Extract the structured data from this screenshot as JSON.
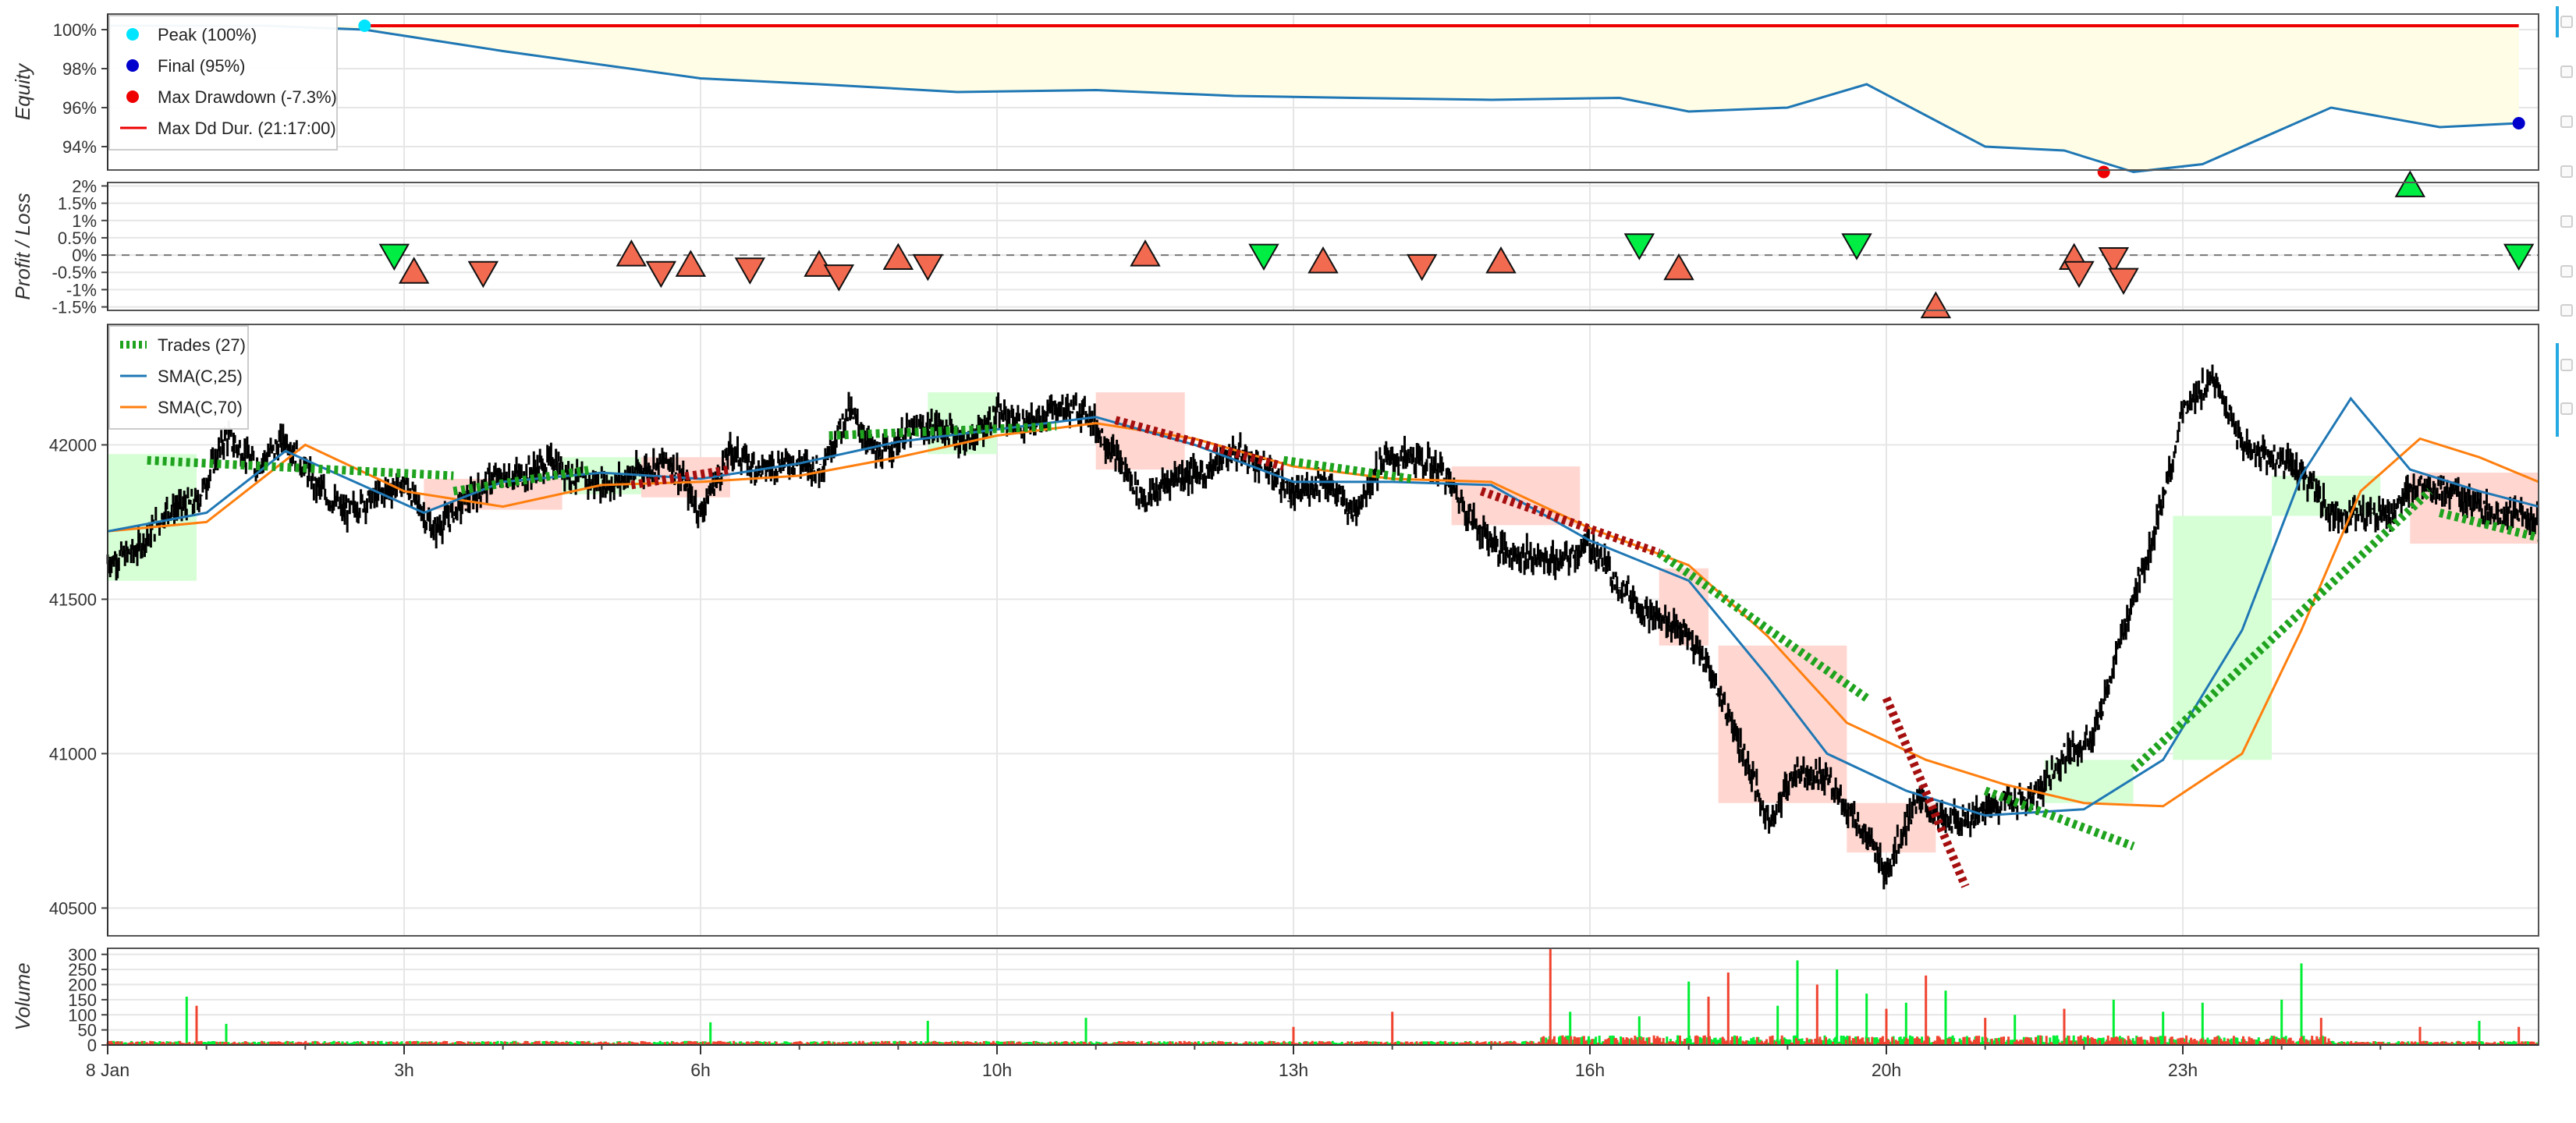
{
  "chart_data": [
    {
      "type": "area",
      "panel": "equity",
      "ylabel": "Equity",
      "yticks": [
        "100%",
        "98%",
        "96%",
        "94%"
      ],
      "ytick_values": [
        100,
        98,
        96,
        94
      ],
      "ylim": [
        92.8,
        100.8
      ],
      "grid": true,
      "legend_position": "top-left",
      "legend": [
        {
          "label": "Peak (100%)",
          "color": "#00e5ff",
          "marker": "dot"
        },
        {
          "label": "Final (95%)",
          "color": "#0000cc",
          "marker": "dot"
        },
        {
          "label": "Max Drawdown (-7.3%)",
          "color": "#ee0000",
          "marker": "dot"
        },
        {
          "label": "Max Dd Dur. (21:17:00)",
          "color": "#ee0000",
          "marker": "line"
        }
      ],
      "series": [
        {
          "name": "Equity",
          "color": "#1f77b4",
          "x": [
            0,
            1.6,
            2.6,
            4,
            6,
            7.2,
            8.6,
            10,
            11.4,
            12.6,
            14,
            15.3,
            16,
            17,
            17.8,
            18.4,
            19,
            19.8,
            20.5,
            21.2,
            22.5,
            23.6,
            24.4
          ],
          "values": [
            100.2,
            100.2,
            100.0,
            98.9,
            97.5,
            97.2,
            96.8,
            96.9,
            96.6,
            96.5,
            96.4,
            96.5,
            95.8,
            96.0,
            97.2,
            95.6,
            94.0,
            93.8,
            92.7,
            93.1,
            96.0,
            95.0,
            95.2
          ]
        }
      ],
      "markers": [
        {
          "name": "Peak",
          "x": 2.6,
          "y": 100.2,
          "color": "#00e5ff"
        },
        {
          "name": "Final",
          "x": 24.4,
          "y": 95.2,
          "color": "#0000cc"
        },
        {
          "name": "Max Drawdown",
          "x": 20.2,
          "y": 92.7,
          "color": "#ee0000"
        }
      ],
      "max_dd_duration": {
        "x_start": 2.6,
        "x_end": 24.4,
        "y": 100.2,
        "color": "#ee0000"
      },
      "drawdown_fill_color": "#fffde6"
    },
    {
      "type": "scatter",
      "panel": "profit_loss",
      "ylabel": "Profit / Loss",
      "yticks": [
        "2%",
        "1.5%",
        "1%",
        "0.5%",
        "0%",
        "-0.5%",
        "-1%",
        "-1.5%"
      ],
      "ytick_values": [
        2,
        1.5,
        1,
        0.5,
        0,
        -0.5,
        -1,
        -1.5
      ],
      "ylim": [
        -1.6,
        2.1
      ],
      "grid": true,
      "points": [
        {
          "x": 2.9,
          "y": 0.0,
          "dir": "down",
          "win": true
        },
        {
          "x": 3.1,
          "y": -0.5,
          "dir": "up",
          "win": false
        },
        {
          "x": 3.8,
          "y": -0.5,
          "dir": "down",
          "win": false
        },
        {
          "x": 5.3,
          "y": 0.0,
          "dir": "up",
          "win": false
        },
        {
          "x": 5.6,
          "y": -0.5,
          "dir": "down",
          "win": false
        },
        {
          "x": 5.9,
          "y": -0.3,
          "dir": "up",
          "win": false
        },
        {
          "x": 6.5,
          "y": -0.4,
          "dir": "down",
          "win": false
        },
        {
          "x": 7.2,
          "y": -0.3,
          "dir": "up",
          "win": false
        },
        {
          "x": 7.4,
          "y": -0.6,
          "dir": "down",
          "win": false
        },
        {
          "x": 8.0,
          "y": -0.1,
          "dir": "up",
          "win": false
        },
        {
          "x": 8.3,
          "y": -0.3,
          "dir": "down",
          "win": false
        },
        {
          "x": 10.5,
          "y": 0.0,
          "dir": "up",
          "win": false
        },
        {
          "x": 11.7,
          "y": 0.0,
          "dir": "down",
          "win": true
        },
        {
          "x": 12.3,
          "y": -0.2,
          "dir": "up",
          "win": false
        },
        {
          "x": 13.3,
          "y": -0.3,
          "dir": "down",
          "win": false
        },
        {
          "x": 14.1,
          "y": -0.2,
          "dir": "up",
          "win": false
        },
        {
          "x": 15.5,
          "y": 0.3,
          "dir": "down",
          "win": true
        },
        {
          "x": 15.9,
          "y": -0.4,
          "dir": "up",
          "win": false
        },
        {
          "x": 17.7,
          "y": 0.3,
          "dir": "down",
          "win": true
        },
        {
          "x": 18.5,
          "y": -1.5,
          "dir": "up",
          "win": false
        },
        {
          "x": 19.9,
          "y": -0.1,
          "dir": "up",
          "win": false
        },
        {
          "x": 19.95,
          "y": -0.5,
          "dir": "down",
          "win": false
        },
        {
          "x": 20.3,
          "y": -0.1,
          "dir": "down",
          "win": false
        },
        {
          "x": 20.4,
          "y": -0.7,
          "dir": "down",
          "win": false
        },
        {
          "x": 23.3,
          "y": 2.0,
          "dir": "up",
          "win": true
        },
        {
          "x": 24.4,
          "y": 0.0,
          "dir": "down",
          "win": true
        }
      ],
      "win_color": "#00ee44",
      "loss_color": "#f26a50"
    },
    {
      "type": "line",
      "panel": "ohlc",
      "yticks": [
        "42000",
        "41500",
        "41000",
        "40500"
      ],
      "ytick_values": [
        42000,
        41500,
        41000,
        40500
      ],
      "ylim": [
        40410,
        42390
      ],
      "grid": true,
      "legend_position": "top-left",
      "legend": [
        {
          "label": "Trades (27)",
          "color": "#1fa31f",
          "style": "dashed-thick"
        },
        {
          "label": "SMA(C,25)",
          "color": "#1f77b4",
          "style": "line"
        },
        {
          "label": "SMA(C,70)",
          "color": "#ff7f0e",
          "style": "line"
        }
      ],
      "price": {
        "x": [
          0,
          0.3,
          0.6,
          0.9,
          1.2,
          1.5,
          1.8,
          2.1,
          2.4,
          2.7,
          3.0,
          3.3,
          3.6,
          3.9,
          4.2,
          4.5,
          4.8,
          5.1,
          5.4,
          5.7,
          6.0,
          6.3,
          6.6,
          6.9,
          7.2,
          7.5,
          7.8,
          8.1,
          8.4,
          8.7,
          9.0,
          9.3,
          9.6,
          9.9,
          10.2,
          10.5,
          10.8,
          11.1,
          11.4,
          11.7,
          12.0,
          12.3,
          12.6,
          12.9,
          13.2,
          13.5,
          13.8,
          14.1,
          14.4,
          14.7,
          15.0,
          15.3,
          15.6,
          15.9,
          16.2,
          16.5,
          16.8,
          17.1,
          17.4,
          17.7,
          18.0,
          18.3,
          18.6,
          18.9,
          19.2,
          19.5,
          19.8,
          20.1,
          20.4,
          20.7,
          21.0,
          21.3,
          21.6,
          21.9,
          22.2,
          22.5,
          22.8,
          23.1,
          23.4,
          23.7,
          24.0,
          24.3,
          24.6
        ],
        "values": [
          41620,
          41660,
          41790,
          41810,
          42030,
          41930,
          42020,
          41870,
          41780,
          41830,
          41880,
          41720,
          41810,
          41890,
          41900,
          41950,
          41880,
          41870,
          41920,
          41950,
          41780,
          41980,
          41920,
          41950,
          41920,
          42110,
          41960,
          42040,
          42060,
          42010,
          42100,
          42060,
          42120,
          42110,
          41960,
          41820,
          41900,
          41910,
          41980,
          41930,
          41830,
          41890,
          41780,
          41950,
          41960,
          41920,
          41760,
          41660,
          41640,
          41620,
          41680,
          41550,
          41450,
          41410,
          41280,
          41050,
          40780,
          40950,
          40920,
          40780,
          40620,
          40850,
          40780,
          40800,
          40850,
          40850,
          41000,
          41050,
          41400,
          41700,
          42100,
          42220,
          42000,
          41960,
          41910,
          41780,
          41780,
          41780,
          41880,
          41850,
          41790,
          41780,
          41750
        ]
      },
      "sma_25": {
        "x": [
          0,
          1,
          1.8,
          2.5,
          3.2,
          4,
          5,
          6,
          7,
          8,
          9,
          10,
          11,
          12,
          13,
          14,
          15,
          16,
          16.8,
          17.4,
          18.2,
          19,
          20,
          20.8,
          21.6,
          22.2,
          22.7,
          23.3,
          24,
          24.6
        ],
        "values": [
          41720,
          41780,
          41980,
          41880,
          41780,
          41880,
          41910,
          41890,
          41940,
          42010,
          42050,
          42090,
          42000,
          41880,
          41880,
          41870,
          41690,
          41560,
          41250,
          41000,
          40880,
          40800,
          40820,
          40980,
          41400,
          41900,
          42150,
          41920,
          41850,
          41800
        ]
      },
      "sma_70": {
        "x": [
          0,
          1,
          2,
          3,
          4,
          5,
          6,
          7,
          8,
          9,
          10,
          11,
          12,
          13,
          14,
          15,
          16,
          16.8,
          17.6,
          18.4,
          19.2,
          20,
          20.8,
          21.6,
          22.2,
          22.8,
          23.4,
          24,
          24.6
        ],
        "values": [
          41720,
          41750,
          42000,
          41850,
          41800,
          41870,
          41880,
          41900,
          41960,
          42030,
          42070,
          42020,
          41930,
          41890,
          41880,
          41730,
          41610,
          41380,
          41100,
          40980,
          40900,
          40840,
          40830,
          41000,
          41400,
          41850,
          42020,
          41960,
          41880
        ]
      },
      "trades": [
        {
          "x1": 0.4,
          "y1": 41950,
          "x2": 3.5,
          "y2": 41900,
          "win": true
        },
        {
          "x1": 3.5,
          "y1": 41850,
          "x2": 4.9,
          "y2": 41920,
          "win": true
        },
        {
          "x1": 5.3,
          "y1": 41870,
          "x2": 6.3,
          "y2": 41920,
          "win": false
        },
        {
          "x1": 7.3,
          "y1": 42030,
          "x2": 9.6,
          "y2": 42060,
          "win": true
        },
        {
          "x1": 10.2,
          "y1": 42080,
          "x2": 11.9,
          "y2": 41930,
          "win": false
        },
        {
          "x1": 11.9,
          "y1": 41950,
          "x2": 13.2,
          "y2": 41890,
          "win": true
        },
        {
          "x1": 13.9,
          "y1": 41850,
          "x2": 15.7,
          "y2": 41650,
          "win": false
        },
        {
          "x1": 15.7,
          "y1": 41650,
          "x2": 17.8,
          "y2": 41180,
          "win": true
        },
        {
          "x1": 18.0,
          "y1": 41180,
          "x2": 18.8,
          "y2": 40570,
          "win": false
        },
        {
          "x1": 19.0,
          "y1": 40880,
          "x2": 20.5,
          "y2": 40700,
          "win": true
        },
        {
          "x1": 20.5,
          "y1": 40950,
          "x2": 23.5,
          "y2": 41850,
          "win": true
        },
        {
          "x1": 23.6,
          "y1": 41780,
          "x2": 24.6,
          "y2": 41700,
          "win": true
        }
      ],
      "trade_win_color": "#1fa31f",
      "trade_loss_color": "#a50f0f",
      "boxes": [
        {
          "x1": 0.0,
          "x2": 0.9,
          "y1": 41560,
          "y2": 41970,
          "win": true
        },
        {
          "x1": 3.2,
          "x2": 4.6,
          "y1": 41790,
          "y2": 41890,
          "win": false
        },
        {
          "x1": 4.6,
          "x2": 5.4,
          "y1": 41840,
          "y2": 41960,
          "win": true
        },
        {
          "x1": 5.4,
          "x2": 6.3,
          "y1": 41830,
          "y2": 41960,
          "win": false
        },
        {
          "x1": 8.3,
          "x2": 9.0,
          "y1": 41970,
          "y2": 42170,
          "win": true
        },
        {
          "x1": 10.0,
          "x2": 10.9,
          "y1": 41920,
          "y2": 42170,
          "win": false
        },
        {
          "x1": 13.6,
          "x2": 14.9,
          "y1": 41740,
          "y2": 41930,
          "win": false
        },
        {
          "x1": 15.7,
          "x2": 16.2,
          "y1": 41350,
          "y2": 41600,
          "win": false
        },
        {
          "x1": 16.3,
          "x2": 17.6,
          "y1": 40840,
          "y2": 41350,
          "win": false
        },
        {
          "x1": 17.6,
          "x2": 18.5,
          "y1": 40680,
          "y2": 40840,
          "win": false
        },
        {
          "x1": 19.6,
          "x2": 20.5,
          "y1": 40840,
          "y2": 40980,
          "win": true
        },
        {
          "x1": 20.9,
          "x2": 21.9,
          "y1": 40980,
          "y2": 41770,
          "win": true
        },
        {
          "x1": 21.9,
          "x2": 23.0,
          "y1": 41770,
          "y2": 41900,
          "win": true
        },
        {
          "x1": 23.3,
          "x2": 24.6,
          "y1": 41680,
          "y2": 41910,
          "win": false
        }
      ],
      "box_win_color": "#d6ffd6",
      "box_loss_color": "#ffd6d0"
    },
    {
      "type": "bar",
      "panel": "volume",
      "ylabel": "Volume",
      "yticks": [
        "300",
        "250",
        "200",
        "150",
        "100",
        "50",
        "0"
      ],
      "ytick_values": [
        300,
        250,
        200,
        150,
        100,
        50,
        0
      ],
      "ylim": [
        0,
        320
      ],
      "grid": true,
      "spikes": [
        {
          "x": 0.8,
          "v": 160,
          "up": true
        },
        {
          "x": 0.9,
          "v": 130,
          "up": false
        },
        {
          "x": 1.2,
          "v": 70,
          "up": true
        },
        {
          "x": 6.1,
          "v": 75,
          "up": true
        },
        {
          "x": 8.3,
          "v": 80,
          "up": true
        },
        {
          "x": 9.9,
          "v": 90,
          "up": true
        },
        {
          "x": 12.0,
          "v": 60,
          "up": false
        },
        {
          "x": 13.0,
          "v": 110,
          "up": false
        },
        {
          "x": 14.6,
          "v": 320,
          "up": false
        },
        {
          "x": 14.8,
          "v": 110,
          "up": true
        },
        {
          "x": 15.5,
          "v": 95,
          "up": true
        },
        {
          "x": 16.0,
          "v": 210,
          "up": true
        },
        {
          "x": 16.2,
          "v": 160,
          "up": false
        },
        {
          "x": 16.4,
          "v": 240,
          "up": false
        },
        {
          "x": 16.9,
          "v": 130,
          "up": true
        },
        {
          "x": 17.1,
          "v": 280,
          "up": true
        },
        {
          "x": 17.3,
          "v": 200,
          "up": false
        },
        {
          "x": 17.5,
          "v": 250,
          "up": true
        },
        {
          "x": 17.8,
          "v": 170,
          "up": true
        },
        {
          "x": 18.0,
          "v": 120,
          "up": false
        },
        {
          "x": 18.2,
          "v": 140,
          "up": true
        },
        {
          "x": 18.4,
          "v": 230,
          "up": false
        },
        {
          "x": 18.6,
          "v": 180,
          "up": true
        },
        {
          "x": 19.0,
          "v": 90,
          "up": false
        },
        {
          "x": 19.3,
          "v": 100,
          "up": true
        },
        {
          "x": 19.8,
          "v": 120,
          "up": false
        },
        {
          "x": 20.3,
          "v": 150,
          "up": true
        },
        {
          "x": 20.8,
          "v": 110,
          "up": true
        },
        {
          "x": 21.2,
          "v": 140,
          "up": true
        },
        {
          "x": 22.0,
          "v": 150,
          "up": true
        },
        {
          "x": 22.2,
          "v": 270,
          "up": true
        },
        {
          "x": 22.4,
          "v": 90,
          "up": false
        },
        {
          "x": 23.4,
          "v": 60,
          "up": false
        },
        {
          "x": 24.0,
          "v": 80,
          "up": true
        },
        {
          "x": 24.4,
          "v": 60,
          "up": false
        }
      ],
      "up_color": "#00ee33",
      "down_color": "#f0432f"
    }
  ],
  "x_axis": {
    "tick_labels": [
      "8 Jan",
      "3h",
      "6h",
      "10h",
      "13h",
      "16h",
      "20h",
      "23h"
    ],
    "tick_values": [
      0,
      3,
      6,
      9,
      12,
      15,
      18,
      21
    ],
    "xlim": [
      0,
      24.6
    ]
  }
}
